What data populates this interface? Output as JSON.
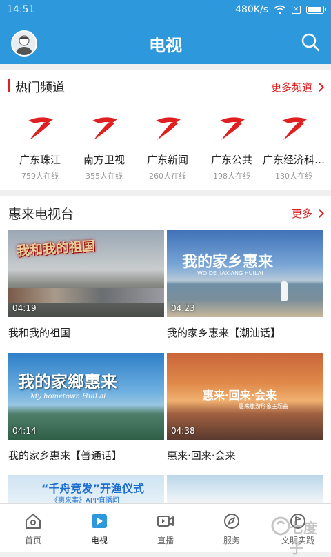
{
  "status": {
    "time": "14:51",
    "speed": "480K/s"
  },
  "header": {
    "title": "电视"
  },
  "hot": {
    "title": "热门频道",
    "more": "更多频道",
    "channels": [
      {
        "name": "广东珠江",
        "count": "759人在线"
      },
      {
        "name": "南方卫视",
        "count": "355人在线"
      },
      {
        "name": "广东新闻",
        "count": "260人在线"
      },
      {
        "name": "广东公共",
        "count": "198人在线"
      },
      {
        "name": "广东经济科…",
        "count": "130人在线"
      }
    ]
  },
  "tv": {
    "title": "惠来电视台",
    "more": "更多",
    "videos": [
      {
        "title": "我和我的祖国",
        "duration": "04:19",
        "overlay": "我和我的祖国"
      },
      {
        "title": "我的家乡惠来【潮汕话】",
        "duration": "04:23",
        "overlay": "我的家乡惠来",
        "overlay_sub": "WO DE JIAXIANG HUILAI"
      },
      {
        "title": "我的家乡惠来【普通话】",
        "duration": "04:14",
        "overlay": "我的家鄉惠来",
        "overlay_sub": "My hometown HuiLai"
      },
      {
        "title": "惠来·回来·会来",
        "duration": "04:38",
        "overlay": "惠来·回来·会来",
        "overlay_sub": "惠来旅游形象主题曲"
      },
      {
        "overlay": "“千舟竞发”开渔仪式",
        "overlay_sub": "《惠来事》APP直播间"
      }
    ]
  },
  "tabs": [
    {
      "label": "首页",
      "icon": "home-icon"
    },
    {
      "label": "电视",
      "icon": "tv-play-icon"
    },
    {
      "label": "直播",
      "icon": "video-camera-icon"
    },
    {
      "label": "服务",
      "icon": "compass-icon"
    },
    {
      "label": "文明实践",
      "icon": "flag-circle-icon"
    }
  ],
  "watermark": "七度子",
  "colors": {
    "primary": "#2e98dd",
    "accent": "#e02020"
  },
  "battery_level": 0.95
}
